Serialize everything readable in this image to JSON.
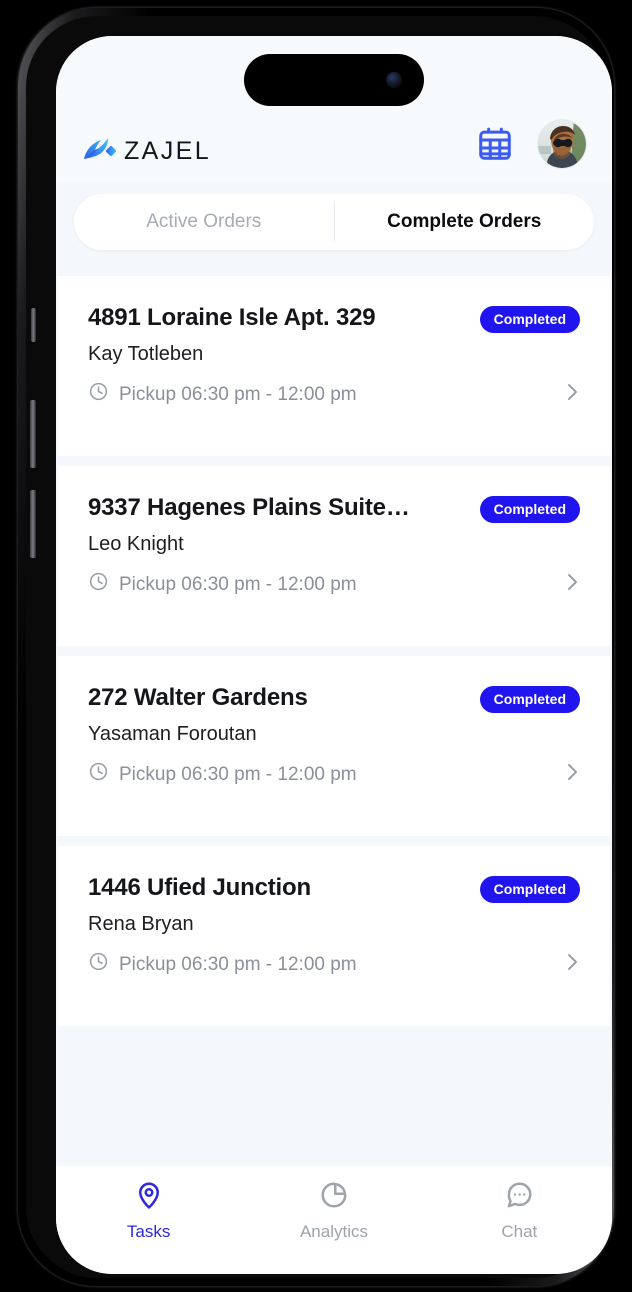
{
  "app": {
    "brand_name": "ZAJEL",
    "logo_icon": "dove-bird-logo-icon"
  },
  "header": {
    "calendar_icon": "calendar-icon",
    "avatar_icon": "user-avatar",
    "accent_blue": "#3b5bf5"
  },
  "tabs": [
    {
      "label": "Active Orders",
      "active": false
    },
    {
      "label": "Complete Orders",
      "active": true
    }
  ],
  "orders": [
    {
      "address": "4891 Loraine Isle Apt. 329",
      "person": "Kay Totleben",
      "pickup": "Pickup 06:30 pm - 12:00 pm",
      "status": "Completed",
      "clock_icon": "clock-icon",
      "chevron_icon": "chevron-right-icon"
    },
    {
      "address": "9337 Hagenes Plains Suite…",
      "person": "Leo Knight",
      "pickup": "Pickup 06:30 pm - 12:00 pm",
      "status": "Completed",
      "clock_icon": "clock-icon",
      "chevron_icon": "chevron-right-icon"
    },
    {
      "address": "272 Walter Gardens",
      "person": "Yasaman Foroutan",
      "pickup": "Pickup 06:30 pm - 12:00 pm",
      "status": "Completed",
      "clock_icon": "clock-icon",
      "chevron_icon": "chevron-right-icon"
    },
    {
      "address": "1446 Ufied Junction",
      "person": "Rena Bryan",
      "pickup": "Pickup 06:30 pm - 12:00 pm",
      "status": "Completed",
      "clock_icon": "clock-icon",
      "chevron_icon": "chevron-right-icon"
    }
  ],
  "bottom_nav": [
    {
      "label": "Tasks",
      "icon": "location-pin-icon",
      "active": true
    },
    {
      "label": "Analytics",
      "icon": "pie-chart-icon",
      "active": false
    },
    {
      "label": "Chat",
      "icon": "chat-bubble-icon",
      "active": false
    }
  ],
  "colors": {
    "badge_blue": "#2015ee",
    "nav_active": "#2f27e0",
    "nav_idle": "#9ea3ac",
    "screen_bg": "#f4f8fc",
    "card_bg": "#ffffff"
  }
}
